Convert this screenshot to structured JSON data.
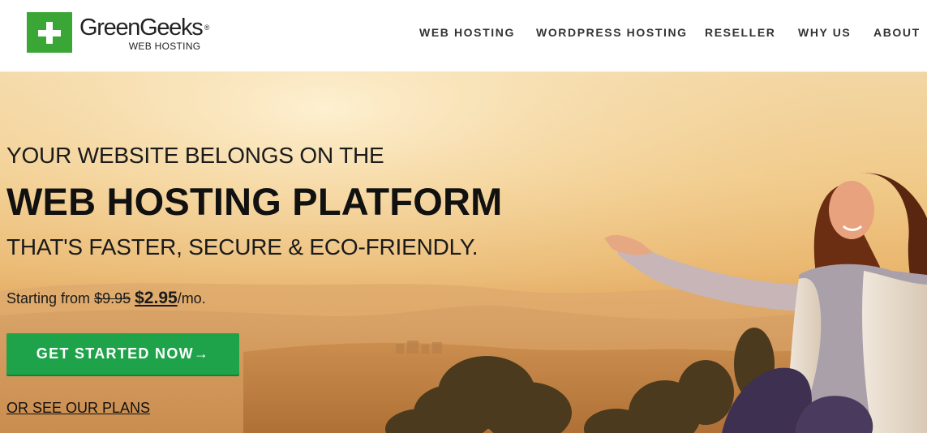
{
  "brand": {
    "name": "GreenGeeks",
    "registered": "®",
    "tagline": "WEB HOSTING",
    "green": "#3aa635"
  },
  "nav": {
    "items": [
      {
        "label": "WEB HOSTING"
      },
      {
        "label": "WORDPRESS HOSTING"
      },
      {
        "label": "RESELLER"
      },
      {
        "label": "WHY US"
      },
      {
        "label": "ABOUT"
      }
    ]
  },
  "hero": {
    "line1": "YOUR WEBSITE BELONGS ON THE",
    "line2": "WEB HOSTING PLATFORM",
    "line3": "THAT'S FASTER, SECURE & ECO-FRIENDLY.",
    "price": {
      "prefix": "Starting from",
      "old_price": "$9.95",
      "new_price": "$2.95",
      "suffix": "/mo."
    },
    "cta_label": "GET STARTED NOW→",
    "cta_color": "#1fa34a",
    "plans_link": "OR SEE OUR PLANS"
  }
}
